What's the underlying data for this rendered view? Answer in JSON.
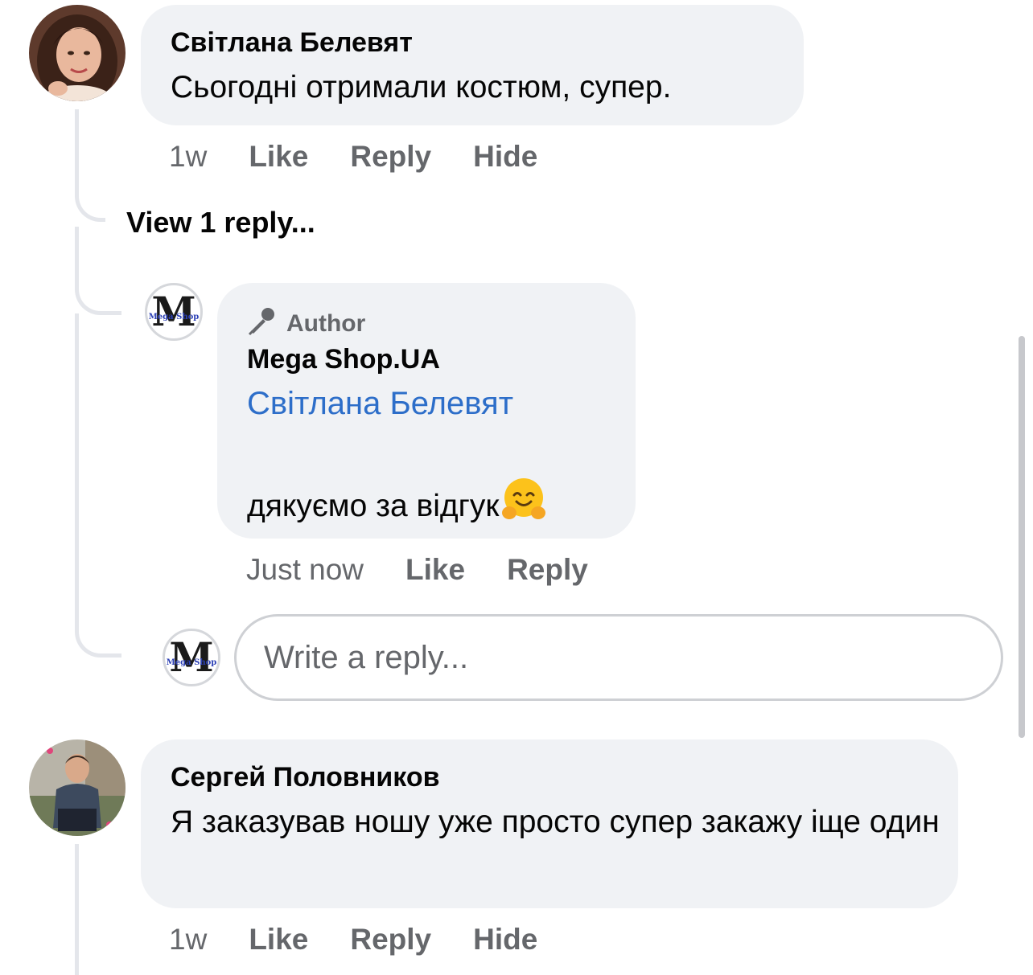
{
  "comments": [
    {
      "author": "Світлана Белевят",
      "text": "Сьогодні отримали костюм, супер.",
      "time": "1w",
      "actions": {
        "like": "Like",
        "reply": "Reply",
        "hide": "Hide"
      },
      "view_replies": "View 1 reply...",
      "replies": [
        {
          "badge": "Author",
          "author": "Mega Shop.UA",
          "mention": "Світлана Белевят",
          "text": "дякуємо за відгук",
          "emoji": "hugging-face-emoji",
          "time": "Just now",
          "actions": {
            "like": "Like",
            "reply": "Reply"
          }
        }
      ],
      "reply_box": {
        "placeholder": "Write a reply..."
      }
    },
    {
      "author": "Сергей Половников",
      "text": "Я заказував ношу уже просто супер закажу іще один",
      "time": "1w",
      "actions": {
        "like": "Like",
        "reply": "Reply",
        "hide": "Hide"
      }
    }
  ],
  "page_avatar_logo": {
    "letter": "M",
    "caption": "Mega Shop"
  },
  "icons": {
    "author_badge": "microphone-icon",
    "scrollbar": "scrollbar-thumb"
  },
  "colors": {
    "bubble": "#f0f2f5",
    "secondary_text": "#65676b",
    "mention": "#2d6ec9",
    "thread_line": "#e4e6eb"
  }
}
